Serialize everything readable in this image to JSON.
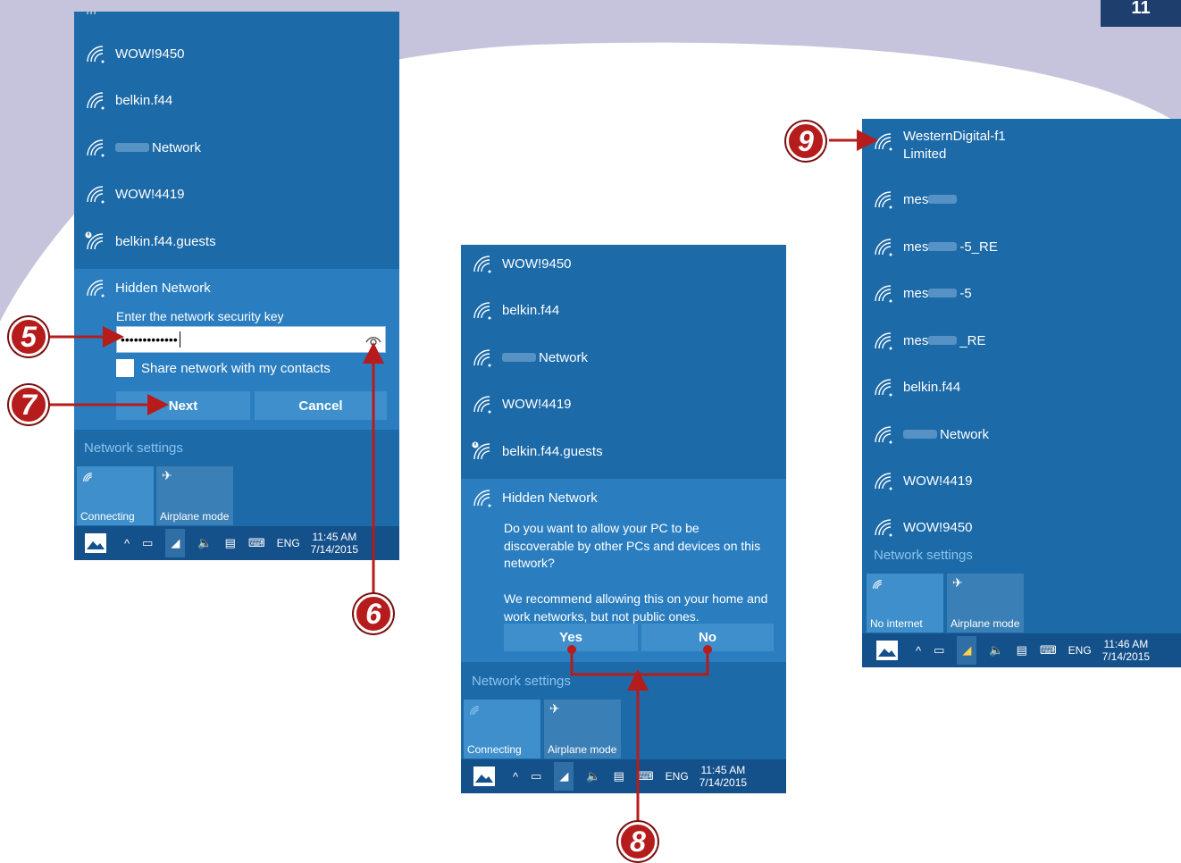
{
  "colors": {
    "panel": "#1c6aa8",
    "panel_expanded": "#2a7ec0",
    "taskbar": "#14508a",
    "button": "#3e8fcb",
    "callout": "#b71c1c",
    "link": "#8cc4ee",
    "background_shape": "#c5c4dc"
  },
  "page": {
    "corner_label": "11"
  },
  "panel1": {
    "networks": [
      {
        "name": "WOW!9450",
        "icon": "wifi-icon"
      },
      {
        "name": "belkin.f44",
        "icon": "wifi-icon"
      },
      {
        "name": "Network",
        "icon": "wifi-icon",
        "name_redacted": true
      },
      {
        "name": "WOW!4419",
        "icon": "wifi-icon"
      },
      {
        "name": "belkin.f44.guests",
        "icon": "wifi-secured-warning-icon"
      }
    ],
    "hidden": {
      "name": "Hidden Network",
      "prompt": "Enter the network security key",
      "key_value": "•••••••••••••",
      "share_label": "Share network with my contacts",
      "next_label": "Next",
      "cancel_label": "Cancel"
    },
    "settings": "Network settings",
    "tiles": [
      {
        "label": "Connecting",
        "icon": "wifi-icon",
        "active": true
      },
      {
        "label": "Airplane mode",
        "icon": "airplane-icon",
        "active": false
      }
    ],
    "taskbar": {
      "lang": "ENG",
      "time": "11:45 AM",
      "date": "7/14/2015"
    }
  },
  "panel2": {
    "networks": [
      {
        "name": "WOW!9450",
        "icon": "wifi-icon"
      },
      {
        "name": "belkin.f44",
        "icon": "wifi-icon"
      },
      {
        "name": "Network",
        "icon": "wifi-icon",
        "name_redacted": true
      },
      {
        "name": "WOW!4419",
        "icon": "wifi-icon"
      },
      {
        "name": "belkin.f44.guests",
        "icon": "wifi-secured-warning-icon"
      }
    ],
    "hidden": {
      "name": "Hidden Network",
      "question": "Do you want to allow your PC to be discoverable by other PCs and devices on this network?",
      "recommend": "We recommend allowing this on your home and work networks, but not public ones.",
      "yes_label": "Yes",
      "no_label": "No"
    },
    "settings": "Network settings",
    "tiles": [
      {
        "label": "Connecting",
        "icon": "wifi-icon",
        "active": true
      },
      {
        "label": "Airplane mode",
        "icon": "airplane-icon",
        "active": false
      }
    ],
    "taskbar": {
      "lang": "ENG",
      "time": "11:45 AM",
      "date": "7/14/2015"
    }
  },
  "panel3": {
    "connected": {
      "name": "WesternDigital-f1",
      "status": "Limited"
    },
    "networks": [
      {
        "prefix": "mes",
        "suffix": ""
      },
      {
        "prefix": "mes",
        "suffix": "-5_RE"
      },
      {
        "prefix": "mes",
        "suffix": "-5"
      },
      {
        "prefix": "mes",
        "suffix": "_RE"
      },
      {
        "prefix": "belkin.f44",
        "suffix": "",
        "plain": true
      },
      {
        "prefix": "",
        "suffix": "Network",
        "redacted_prefix": true
      },
      {
        "prefix": "WOW!4419",
        "suffix": "",
        "plain": true
      },
      {
        "prefix": "WOW!9450",
        "suffix": "",
        "plain": true
      }
    ],
    "settings": "Network settings",
    "tiles": [
      {
        "label": "No internet",
        "icon": "wifi-icon",
        "active": true
      },
      {
        "label": "Airplane mode",
        "icon": "airplane-icon",
        "active": false
      }
    ],
    "taskbar": {
      "lang": "ENG",
      "time": "11:46 AM",
      "date": "7/14/2015"
    }
  },
  "callouts": [
    "5",
    "6",
    "7",
    "8",
    "9"
  ]
}
